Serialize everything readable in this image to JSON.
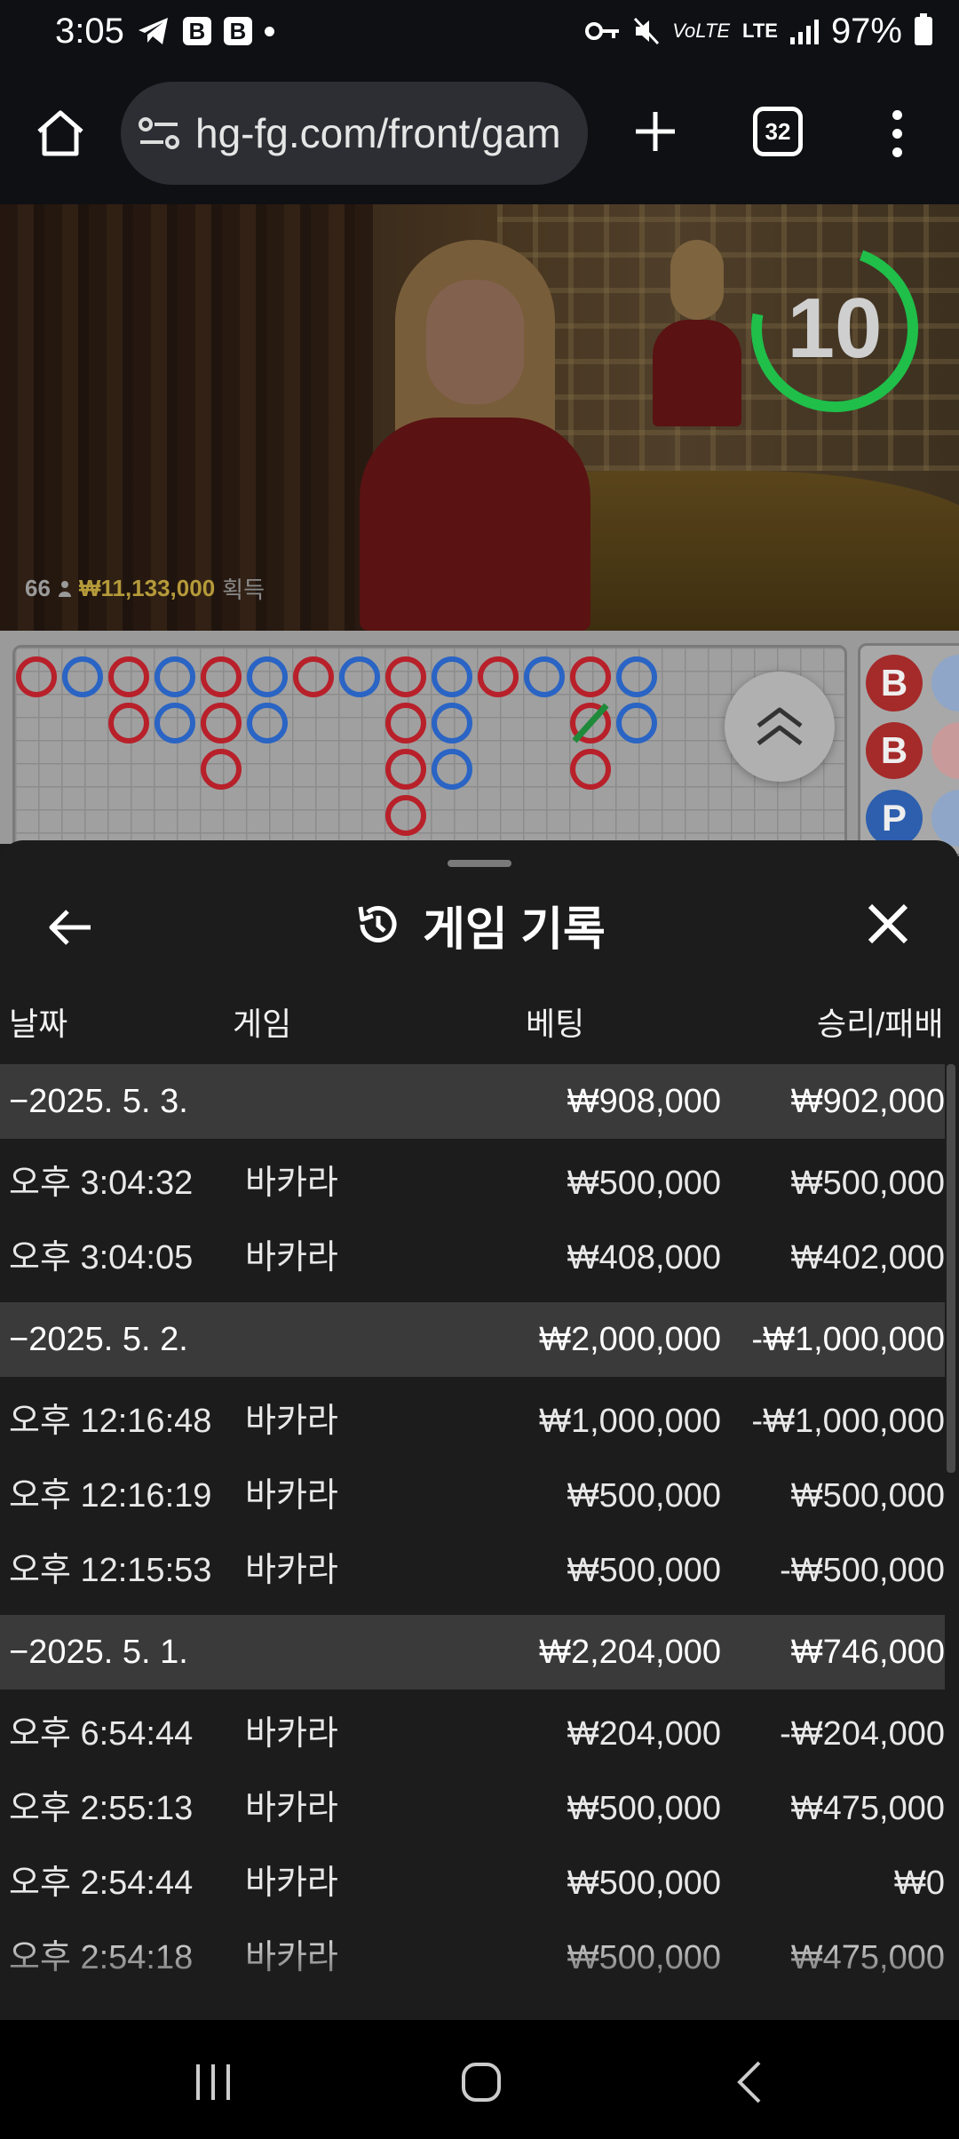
{
  "status_bar": {
    "time": "3:05",
    "notif_b1": "B",
    "notif_b2": "B",
    "network": "LTE",
    "battery": "97%"
  },
  "browser": {
    "url": "hg-fg.com/front/gam",
    "tab_count": "32"
  },
  "video": {
    "timer": "10",
    "win_count": "66",
    "win_amount": "₩11,133,000",
    "win_suffix": "획득"
  },
  "sheet": {
    "title": "게임 기록",
    "columns": {
      "date": "날짜",
      "game": "게임",
      "bet": "베팅",
      "result": "승리/패배"
    },
    "groups": [
      {
        "date": "−2025. 5. 3.",
        "bet_total": "₩908,000",
        "result_total": "₩902,000",
        "rows": [
          {
            "time": "오후 3:04:32",
            "game": "바카라",
            "bet": "₩500,000",
            "result": "₩500,000"
          },
          {
            "time": "오후 3:04:05",
            "game": "바카라",
            "bet": "₩408,000",
            "result": "₩402,000"
          }
        ]
      },
      {
        "date": "−2025. 5. 2.",
        "bet_total": "₩2,000,000",
        "result_total": "-₩1,000,000",
        "rows": [
          {
            "time": "오후 12:16:48",
            "game": "바카라",
            "bet": "₩1,000,000",
            "result": "-₩1,000,000"
          },
          {
            "time": "오후 12:16:19",
            "game": "바카라",
            "bet": "₩500,000",
            "result": "₩500,000"
          },
          {
            "time": "오후 12:15:53",
            "game": "바카라",
            "bet": "₩500,000",
            "result": "-₩500,000"
          }
        ]
      },
      {
        "date": "−2025. 5. 1.",
        "bet_total": "₩2,204,000",
        "result_total": "₩746,000",
        "rows": [
          {
            "time": "오후 6:54:44",
            "game": "바카라",
            "bet": "₩204,000",
            "result": "-₩204,000"
          },
          {
            "time": "오후 2:55:13",
            "game": "바카라",
            "bet": "₩500,000",
            "result": "₩475,000"
          },
          {
            "time": "오후 2:54:44",
            "game": "바카라",
            "bet": "₩500,000",
            "result": "₩0"
          },
          {
            "time": "오후 2:54:18",
            "game": "바카라",
            "bet": "₩500,000",
            "result": "₩475,000"
          }
        ]
      }
    ]
  },
  "side_panel": [
    "B",
    "B",
    "P"
  ],
  "colors": {
    "banker_red": "#b8202a",
    "player_blue": "#2a64c4",
    "timer_green": "#1fbf4a"
  }
}
